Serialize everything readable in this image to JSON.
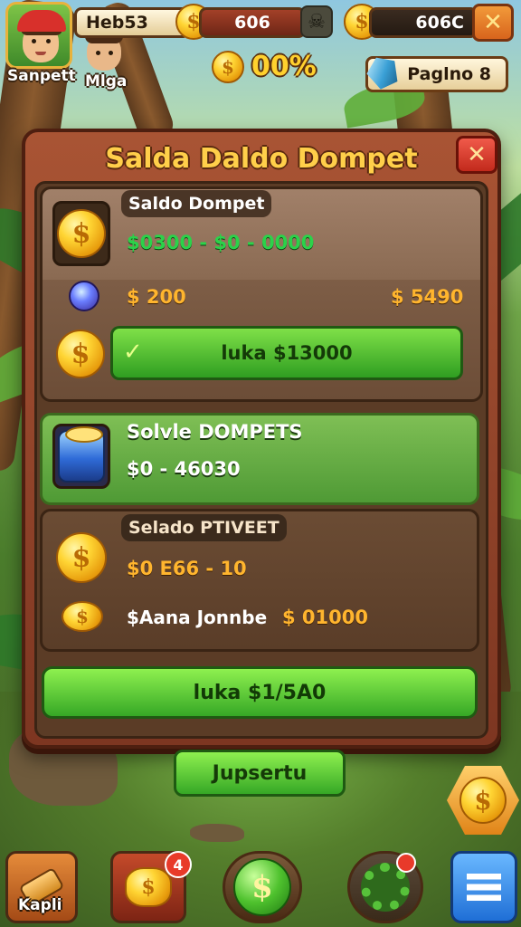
{
  "hud": {
    "player1_name": "Sanpett",
    "player2_name": "Mlga",
    "hero_label": "Heb53",
    "red_counter": "606",
    "gold_counter": "606C",
    "percent": "00%",
    "page_label": "Paglno 8",
    "close_symbol": "✕"
  },
  "panel": {
    "title": "Salda Daldo Dompet",
    "close_symbol": "✕",
    "section1": {
      "tag": "Saldo Dompet",
      "range": "$0300 - $0 - 0000",
      "left_value": "$ 200",
      "right_value": "$ 5490",
      "bar_label": "luka $13000",
      "check_symbol": "✓"
    },
    "section2": {
      "tag": "Solvle DOMPETS",
      "value": "$0 - 46030"
    },
    "section3": {
      "tag": "Selado PTIVEET",
      "value": "$0 E66 - 10",
      "line_label": "$Aana Jonnbe",
      "line_value": "$ 01000"
    },
    "action_button": "luka $1/5A0"
  },
  "below_button": "Jupsertu",
  "bottom_bar": {
    "item1_label": "Kapli",
    "item2_badge": "4",
    "dollar_symbol": "$",
    "menu_icon": "menu-icon"
  },
  "colors": {
    "panel": "#a95434",
    "accent_green": "#36a826",
    "gold": "#ffd534",
    "title": "#ffcf4a"
  }
}
